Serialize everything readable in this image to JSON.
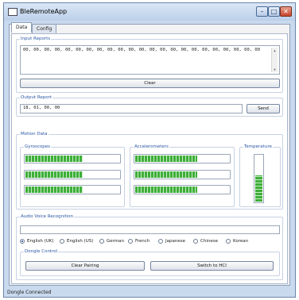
{
  "window": {
    "title": "BleRemoteApp",
    "min_glyph": "–",
    "max_glyph": "□",
    "close_glyph": "✕"
  },
  "tabs": [
    {
      "label": "Data",
      "selected": true
    },
    {
      "label": "Config",
      "selected": false
    }
  ],
  "input_reports": {
    "caption": "Input Reports",
    "value": "00, 00, 00, 00, 00, 00, 00, 00, 00, 00, 00, 00, 00, 00, 00, 00, 00, 00, 00, 00, 00, 00, 00",
    "clear_label": "Clear"
  },
  "output_report": {
    "caption": "Output Report",
    "value": "18, 01, 00, 00",
    "send_label": "Send"
  },
  "motion": {
    "caption": "Motion Data",
    "gyroscopes": {
      "caption": "Gyroscopes",
      "levels": [
        0.6,
        0.6,
        0.6
      ]
    },
    "accelerometers": {
      "caption": "Accelerometers",
      "levels": [
        0.65,
        0.65,
        0.65
      ]
    },
    "temperature": {
      "caption": "Temperature",
      "level": 0.55
    }
  },
  "audio": {
    "caption": "Audio Voice Recognition",
    "text": "",
    "languages": [
      {
        "label": "English (UK)",
        "selected": true
      },
      {
        "label": "English (US)",
        "selected": false
      },
      {
        "label": "German",
        "selected": false
      },
      {
        "label": "French",
        "selected": false
      },
      {
        "label": "Japanese",
        "selected": false
      },
      {
        "label": "Chinese",
        "selected": false
      },
      {
        "label": "Korean",
        "selected": false
      }
    ]
  },
  "dongle": {
    "caption": "Dongle Control",
    "clear_pairing_label": "Clear Pairing",
    "switch_hci_label": "Switch to HCI"
  },
  "status": {
    "text": "Dongle Connected"
  }
}
